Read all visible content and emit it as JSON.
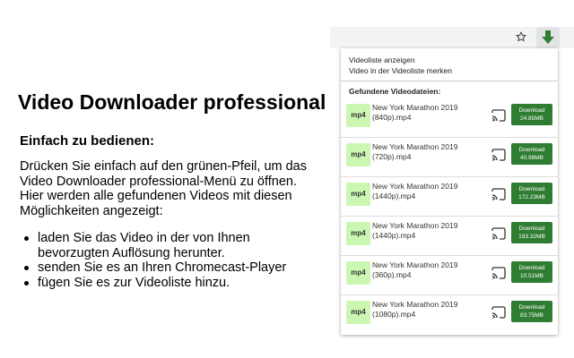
{
  "promo": {
    "title": "Video Downloader professional",
    "subtitle": "Einfach zu bedienen:",
    "body": "Drücken Sie einfach auf den grünen-Pfeil, um das Video Downloader professional-Menü zu öffnen. Hier werden alle gefundenen Videos mit diesen Möglichkeiten angezeigt:",
    "bullets": [
      "laden Sie das Video in der von Ihnen bevorzugten Auflösung herunter.",
      "senden Sie es an Ihren Chromecast-Player",
      "fügen Sie es zur Videoliste hinzu."
    ]
  },
  "toolbar": {
    "star_icon": "star-icon",
    "extension_icon": "download-arrow-icon",
    "accent_color": "#2e7d32"
  },
  "popup": {
    "menu": {
      "show_list": "Videoliste anzeigen",
      "remember": "Video in der Videoliste merken"
    },
    "found_heading": "Gefundene Videodateien:",
    "videos": [
      {
        "badge": "mp4",
        "name": "New York Marathon 2019 (840p).mp4",
        "button": "Download",
        "size": "24.85MB"
      },
      {
        "badge": "mp4",
        "name": "New York Marathon 2019 (720p).mp4",
        "button": "Download",
        "size": "40.98MB"
      },
      {
        "badge": "mp4",
        "name": "New York Marathon 2019 (1440p).mp4",
        "button": "Download",
        "size": "172.23MB"
      },
      {
        "badge": "mp4",
        "name": "New York Marathon 2019 (1440p).mp4",
        "button": "Download",
        "size": "193.32MB"
      },
      {
        "badge": "mp4",
        "name": "New York Marathon 2019 (360p).mp4",
        "button": "Download",
        "size": "10.51MB"
      },
      {
        "badge": "mp4",
        "name": "New York Marathon 2019 (1080p).mp4",
        "button": "Download",
        "size": "83.75MB"
      }
    ],
    "badge_color": "#ccf7b3",
    "button_color": "#2e7d32"
  }
}
